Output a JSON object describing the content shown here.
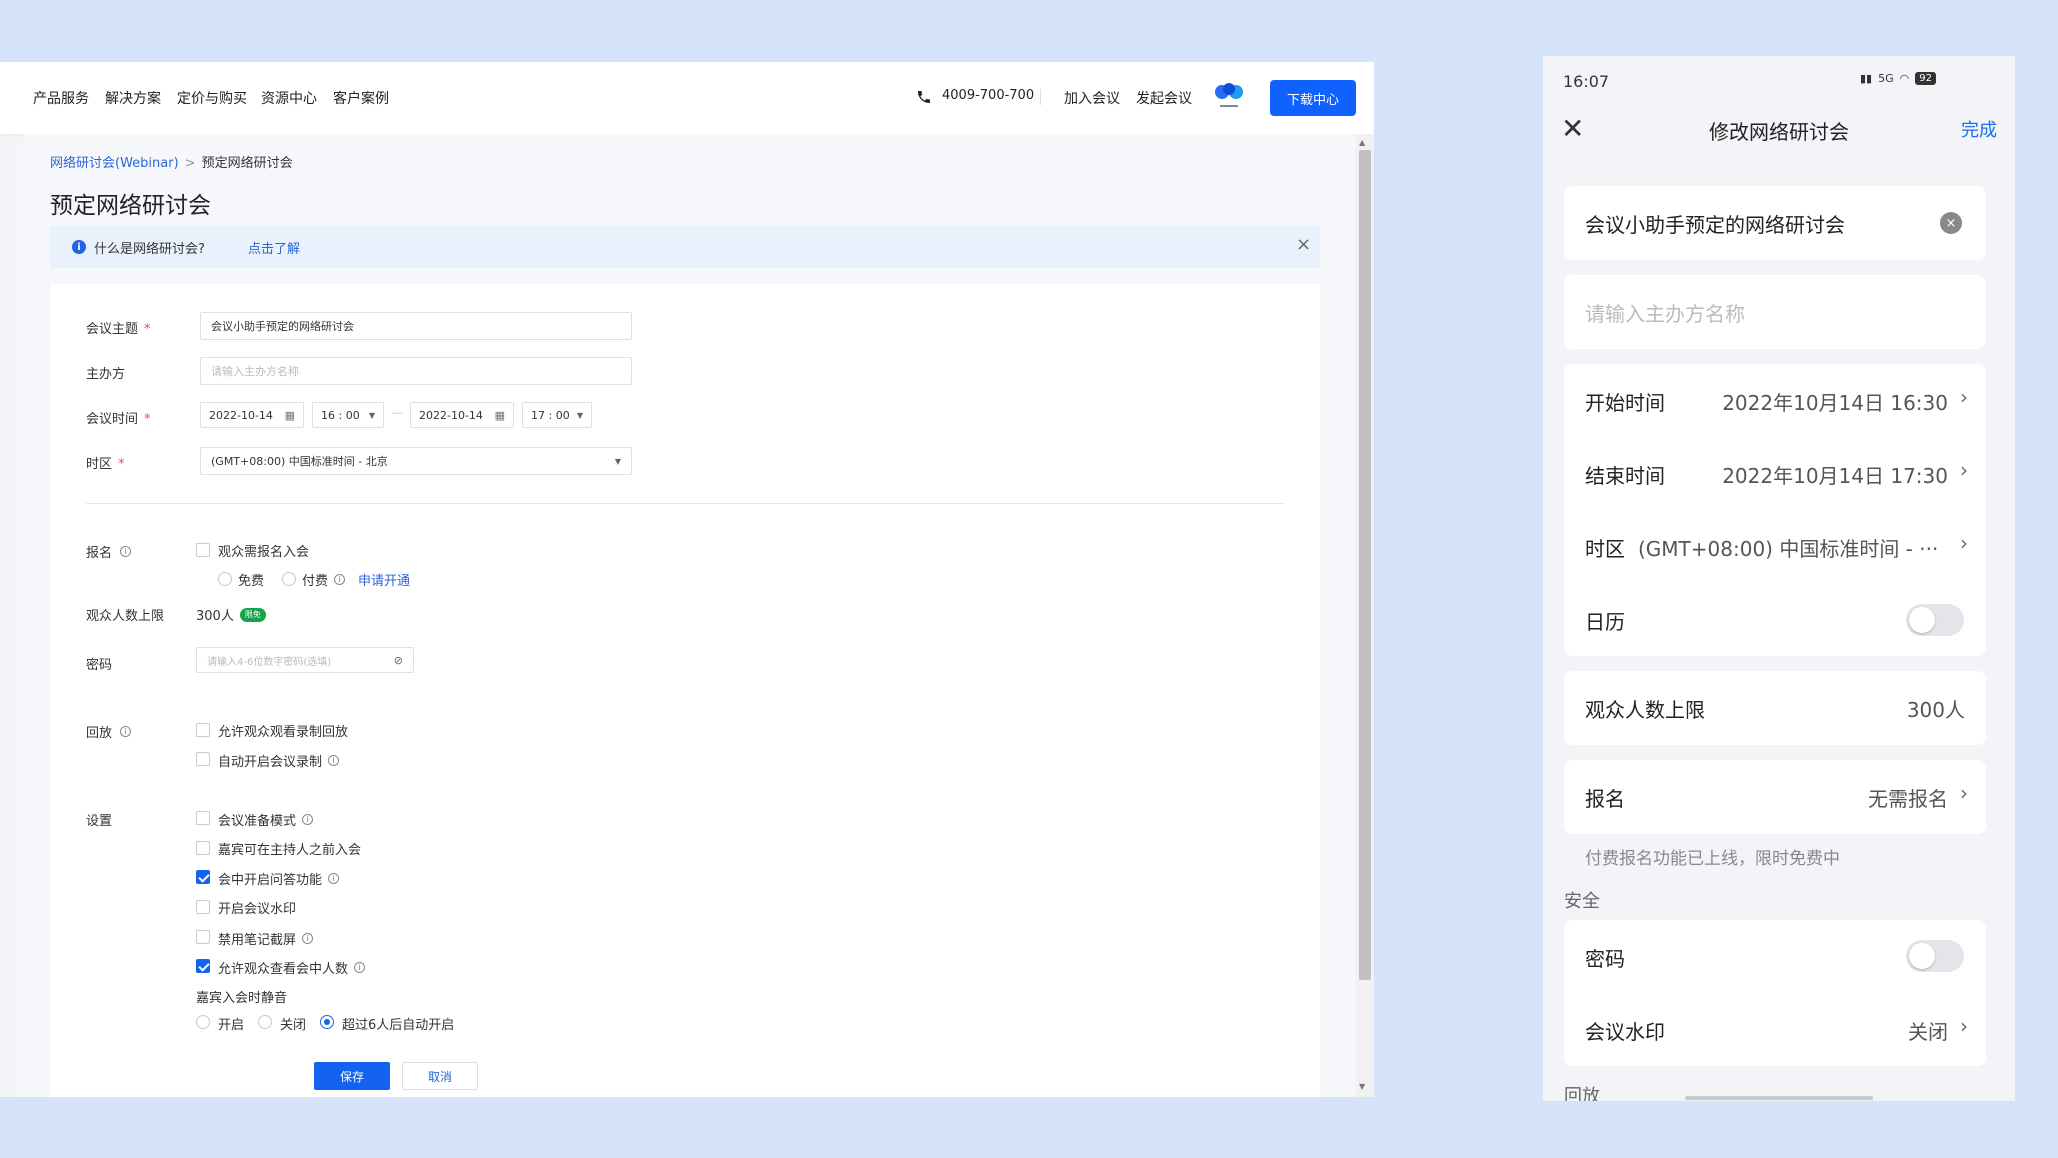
{
  "desktop": {
    "nav": {
      "items": [
        "产品服务",
        "解决方案",
        "定价与购买",
        "资源中心",
        "客户案例"
      ],
      "hotline": "4009-700-700",
      "join_meeting": "加入会议",
      "start_meeting": "发起会议",
      "download": "下载中心",
      "brand_color": "#0f62fe"
    },
    "breadcrumb": {
      "parent": "网络研讨会(Webinar)",
      "separator": ">",
      "current": "预定网络研讨会"
    },
    "page_title": "预定网络研讨会",
    "info_bar": {
      "text": "什么是网络研讨会?",
      "link": "点击了解"
    },
    "form": {
      "topic": {
        "label": "会议主题",
        "required": "*",
        "value": "会议小助手预定的网络研讨会"
      },
      "host": {
        "label": "主办方",
        "placeholder": "请输入主办方名称"
      },
      "time": {
        "label": "会议时间",
        "required": "*",
        "start_date": "2022-10-14",
        "start_time": "16 : 00",
        "end_date": "2022-10-14",
        "end_time": "17 : 00",
        "range_sep": "—"
      },
      "timezone": {
        "label": "时区",
        "required": "*",
        "value": "(GMT+08:00) 中国标准时间 - 北京"
      },
      "registration": {
        "label": "报名",
        "checkbox": "观众需报名入会",
        "free": "免费",
        "paid": "付费",
        "apply_link": "申请开通"
      },
      "audience": {
        "label": "观众人数上限",
        "value": "300人",
        "badge": "限免"
      },
      "password": {
        "label": "密码",
        "placeholder": "请输入4-6位数字密码(选填)"
      },
      "replay": {
        "label": "回放",
        "options": [
          {
            "text": "允许观众观看录制回放",
            "checked": false
          },
          {
            "text": "自动开启会议录制",
            "checked": false
          }
        ]
      },
      "settings": {
        "label": "设置",
        "options": [
          {
            "text": "会议准备模式",
            "checked": false
          },
          {
            "text": "嘉宾可在主持人之前入会",
            "checked": false
          },
          {
            "text": "会中开启问答功能",
            "checked": true
          },
          {
            "text": "开启会议水印",
            "checked": false
          },
          {
            "text": "禁用笔记截屏",
            "checked": false
          },
          {
            "text": "允许观众查看会中人数",
            "checked": true
          }
        ],
        "mute_label": "嘉宾入会时静音",
        "mute_options": [
          "开启",
          "关闭",
          "超过6人后自动开启"
        ],
        "mute_selected": 2
      },
      "save": "保存",
      "cancel": "取消"
    }
  },
  "mobile": {
    "status": {
      "time": "16:07",
      "signal": "5G",
      "battery": "92"
    },
    "title": "修改网络研讨会",
    "close_glyph": "✕",
    "done": "完成",
    "topic": "会议小助手预定的网络研讨会",
    "host_placeholder": "请输入主办方名称",
    "rows": {
      "start": {
        "label": "开始时间",
        "value": "2022年10月14日 16:30"
      },
      "end": {
        "label": "结束时间",
        "value": "2022年10月14日 17:30"
      },
      "timezone": {
        "label": "时区",
        "value": "(GMT+08:00) 中国标准时间 - ···"
      },
      "calendar": {
        "label": "日历",
        "on": false
      },
      "audience": {
        "label": "观众人数上限",
        "value": "300人"
      },
      "registration": {
        "label": "报名",
        "value": "无需报名"
      },
      "password": {
        "label": "密码",
        "on": false
      },
      "watermark": {
        "label": "会议水印",
        "value": "关闭"
      }
    },
    "registration_note": "付费报名功能已上线，限时免费中",
    "security_section": "安全",
    "replay_section": "回放",
    "accent_color": "#1b6cf2"
  }
}
